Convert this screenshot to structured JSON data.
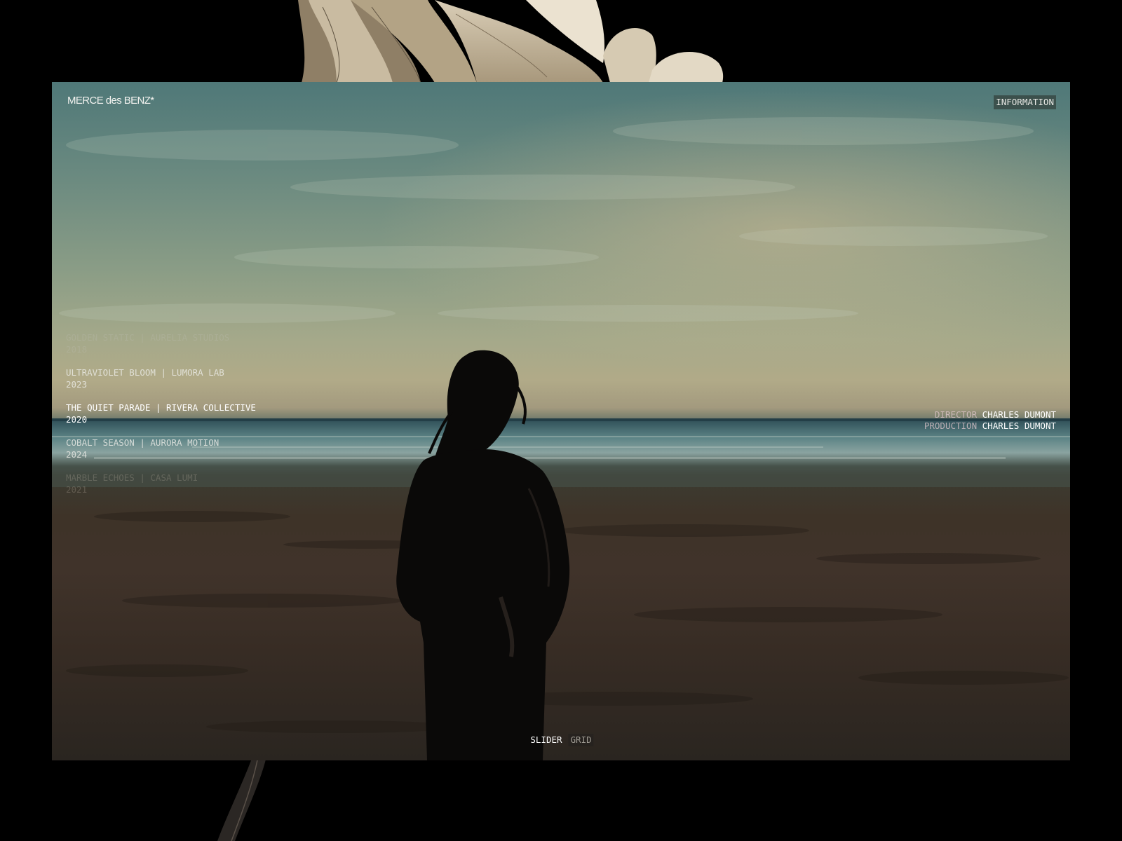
{
  "brand": {
    "logo_text": "MERCE des BENZ*"
  },
  "header": {
    "info_label": "INFORMATION"
  },
  "projects": [
    {
      "title": "GOLDEN STATIC | AURELIA STUDIOS",
      "year": "2018",
      "state": "dim"
    },
    {
      "title": "ULTRAVIOLET BLOOM | LUMORA LAB",
      "year": "2023",
      "state": "normal"
    },
    {
      "title": "THE QUIET PARADE | RIVERA COLLECTIVE",
      "year": "2020",
      "state": "active"
    },
    {
      "title": "COBALT SEASON | AURORA MOTION",
      "year": "2024",
      "state": "normal"
    },
    {
      "title": "MARBLE ECHOES | CASA LUMI",
      "year": "2021",
      "state": "faded"
    }
  ],
  "credits": {
    "director_label": "DIRECTOR",
    "director_value": "CHARLES DUMONT",
    "production_label": "PRODUCTION",
    "production_value": "CHARLES DUMONT"
  },
  "view_switch": {
    "slider_label": "SLIDER",
    "grid_label": "GRID",
    "active": "slider"
  },
  "colors": {
    "background": "#000000",
    "text_active": "#ffffff",
    "sky_top": "#4f7878",
    "sand": "#40332a"
  },
  "icons": {
    "decor_top": "flower-illustration",
    "decor_bottom": "stem-illustration"
  }
}
